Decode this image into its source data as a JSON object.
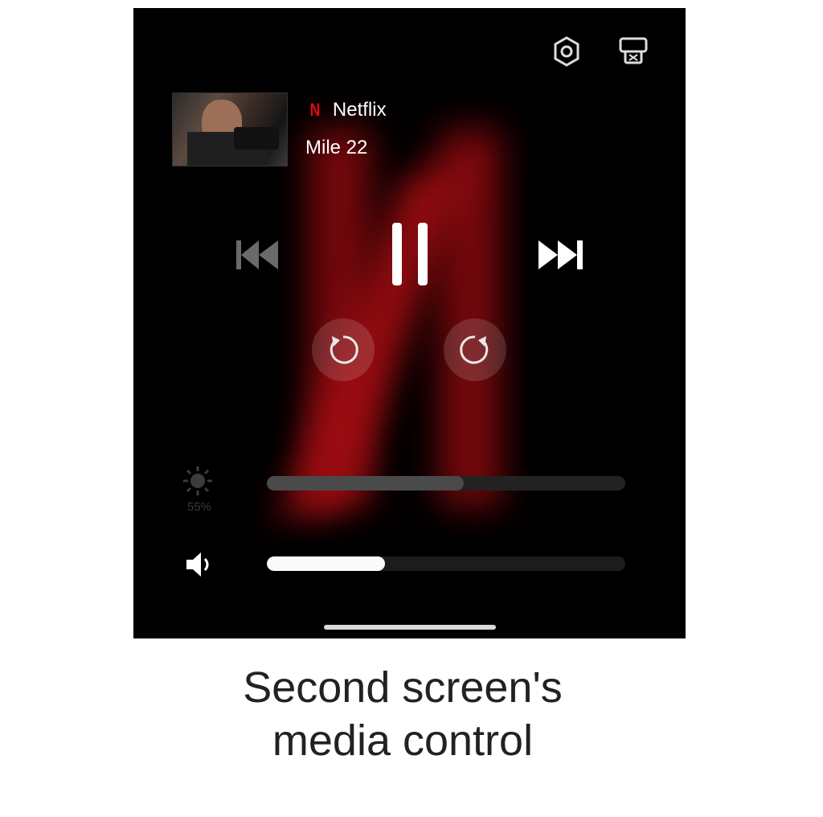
{
  "player": {
    "app_name": "Netflix",
    "app_logo": "N",
    "title": "Mile 22",
    "brand_color": "#e50914",
    "brightness_label": "55%",
    "brightness_level": 0.55,
    "volume_level": 0.33
  },
  "icons": {
    "settings": "gear-icon",
    "cast": "cast-icon",
    "previous": "skip-previous-icon",
    "pause": "pause-icon",
    "next": "skip-next-icon",
    "replay": "replay-icon",
    "forward": "forward-icon",
    "brightness": "sun-icon",
    "volume": "speaker-icon"
  },
  "caption": {
    "line1": "Second screen's",
    "line2": "media control"
  }
}
